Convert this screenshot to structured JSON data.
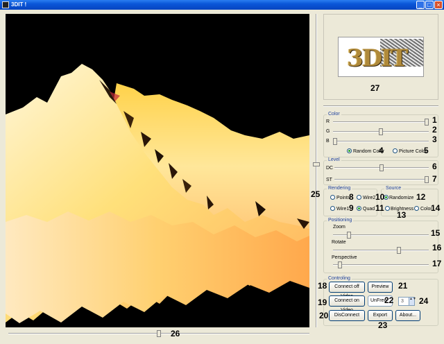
{
  "window": {
    "title": "3DIT !",
    "minimize_glyph": "_",
    "maximize_glyph": "□",
    "close_glyph": "×"
  },
  "icons": [
    "app-icon",
    "minimize-icon",
    "maximize-icon",
    "close-icon"
  ],
  "logo": {
    "text": "3DIT"
  },
  "callouts": {
    "c1": "1",
    "c2": "2",
    "c3": "3",
    "c4": "4",
    "c5": "5",
    "c6": "6",
    "c7": "7",
    "c8": "8",
    "c9": "9",
    "c10": "10",
    "c11": "11",
    "c12": "12",
    "c13": "13",
    "c14": "14",
    "c15": "15",
    "c16": "16",
    "c17": "17",
    "c18": "18",
    "c19": "19",
    "c20": "20",
    "c21": "21",
    "c22": "22",
    "c23": "23",
    "c24": "24",
    "c25": "25",
    "c26": "26",
    "c27": "27"
  },
  "color_group": {
    "title": "Color",
    "r_label": "R",
    "g_label": "G",
    "b_label": "B",
    "r_level": 1.0,
    "g_level": 0.5,
    "b_level": 0.0,
    "random_color": "Random Color",
    "picture_color": "Picture Color",
    "selected": "Random Color"
  },
  "level_group": {
    "title": "Level",
    "dc_label": "DC",
    "st_label": "ST",
    "dc_level": 0.5,
    "st_level": 1.0
  },
  "rendering_group": {
    "title": "Rendering",
    "points": "Points",
    "wire2": "Wire2",
    "wire1": "Wire1",
    "quad": "Quad",
    "selected": "Quad"
  },
  "source_group": {
    "title": "Source",
    "randomize": "Randomize",
    "brightness": "Brightness",
    "color": "Color",
    "selected": "Randomize"
  },
  "positioning_group": {
    "title": "Positioning",
    "zoom_label": "Zoom",
    "rotate_label": "Rotate",
    "perspective_label": "Perspective",
    "zoom_level": 0.15,
    "rotate_level": 0.7,
    "perspective_level": 0.05
  },
  "controlling_group": {
    "title": "Controling",
    "connect_off_video": "Connect off Video",
    "connect_on_video": "Connect on Video",
    "disconnect": "DisConnect",
    "preview": "Preview",
    "unfreeze": "UnFree",
    "export": "Export",
    "about": "About...",
    "spin_value": "3",
    "spin_arrows": "▲▼"
  },
  "view_sliders": {
    "vertical_level": 0.48,
    "horizontal_level": 0.5
  }
}
